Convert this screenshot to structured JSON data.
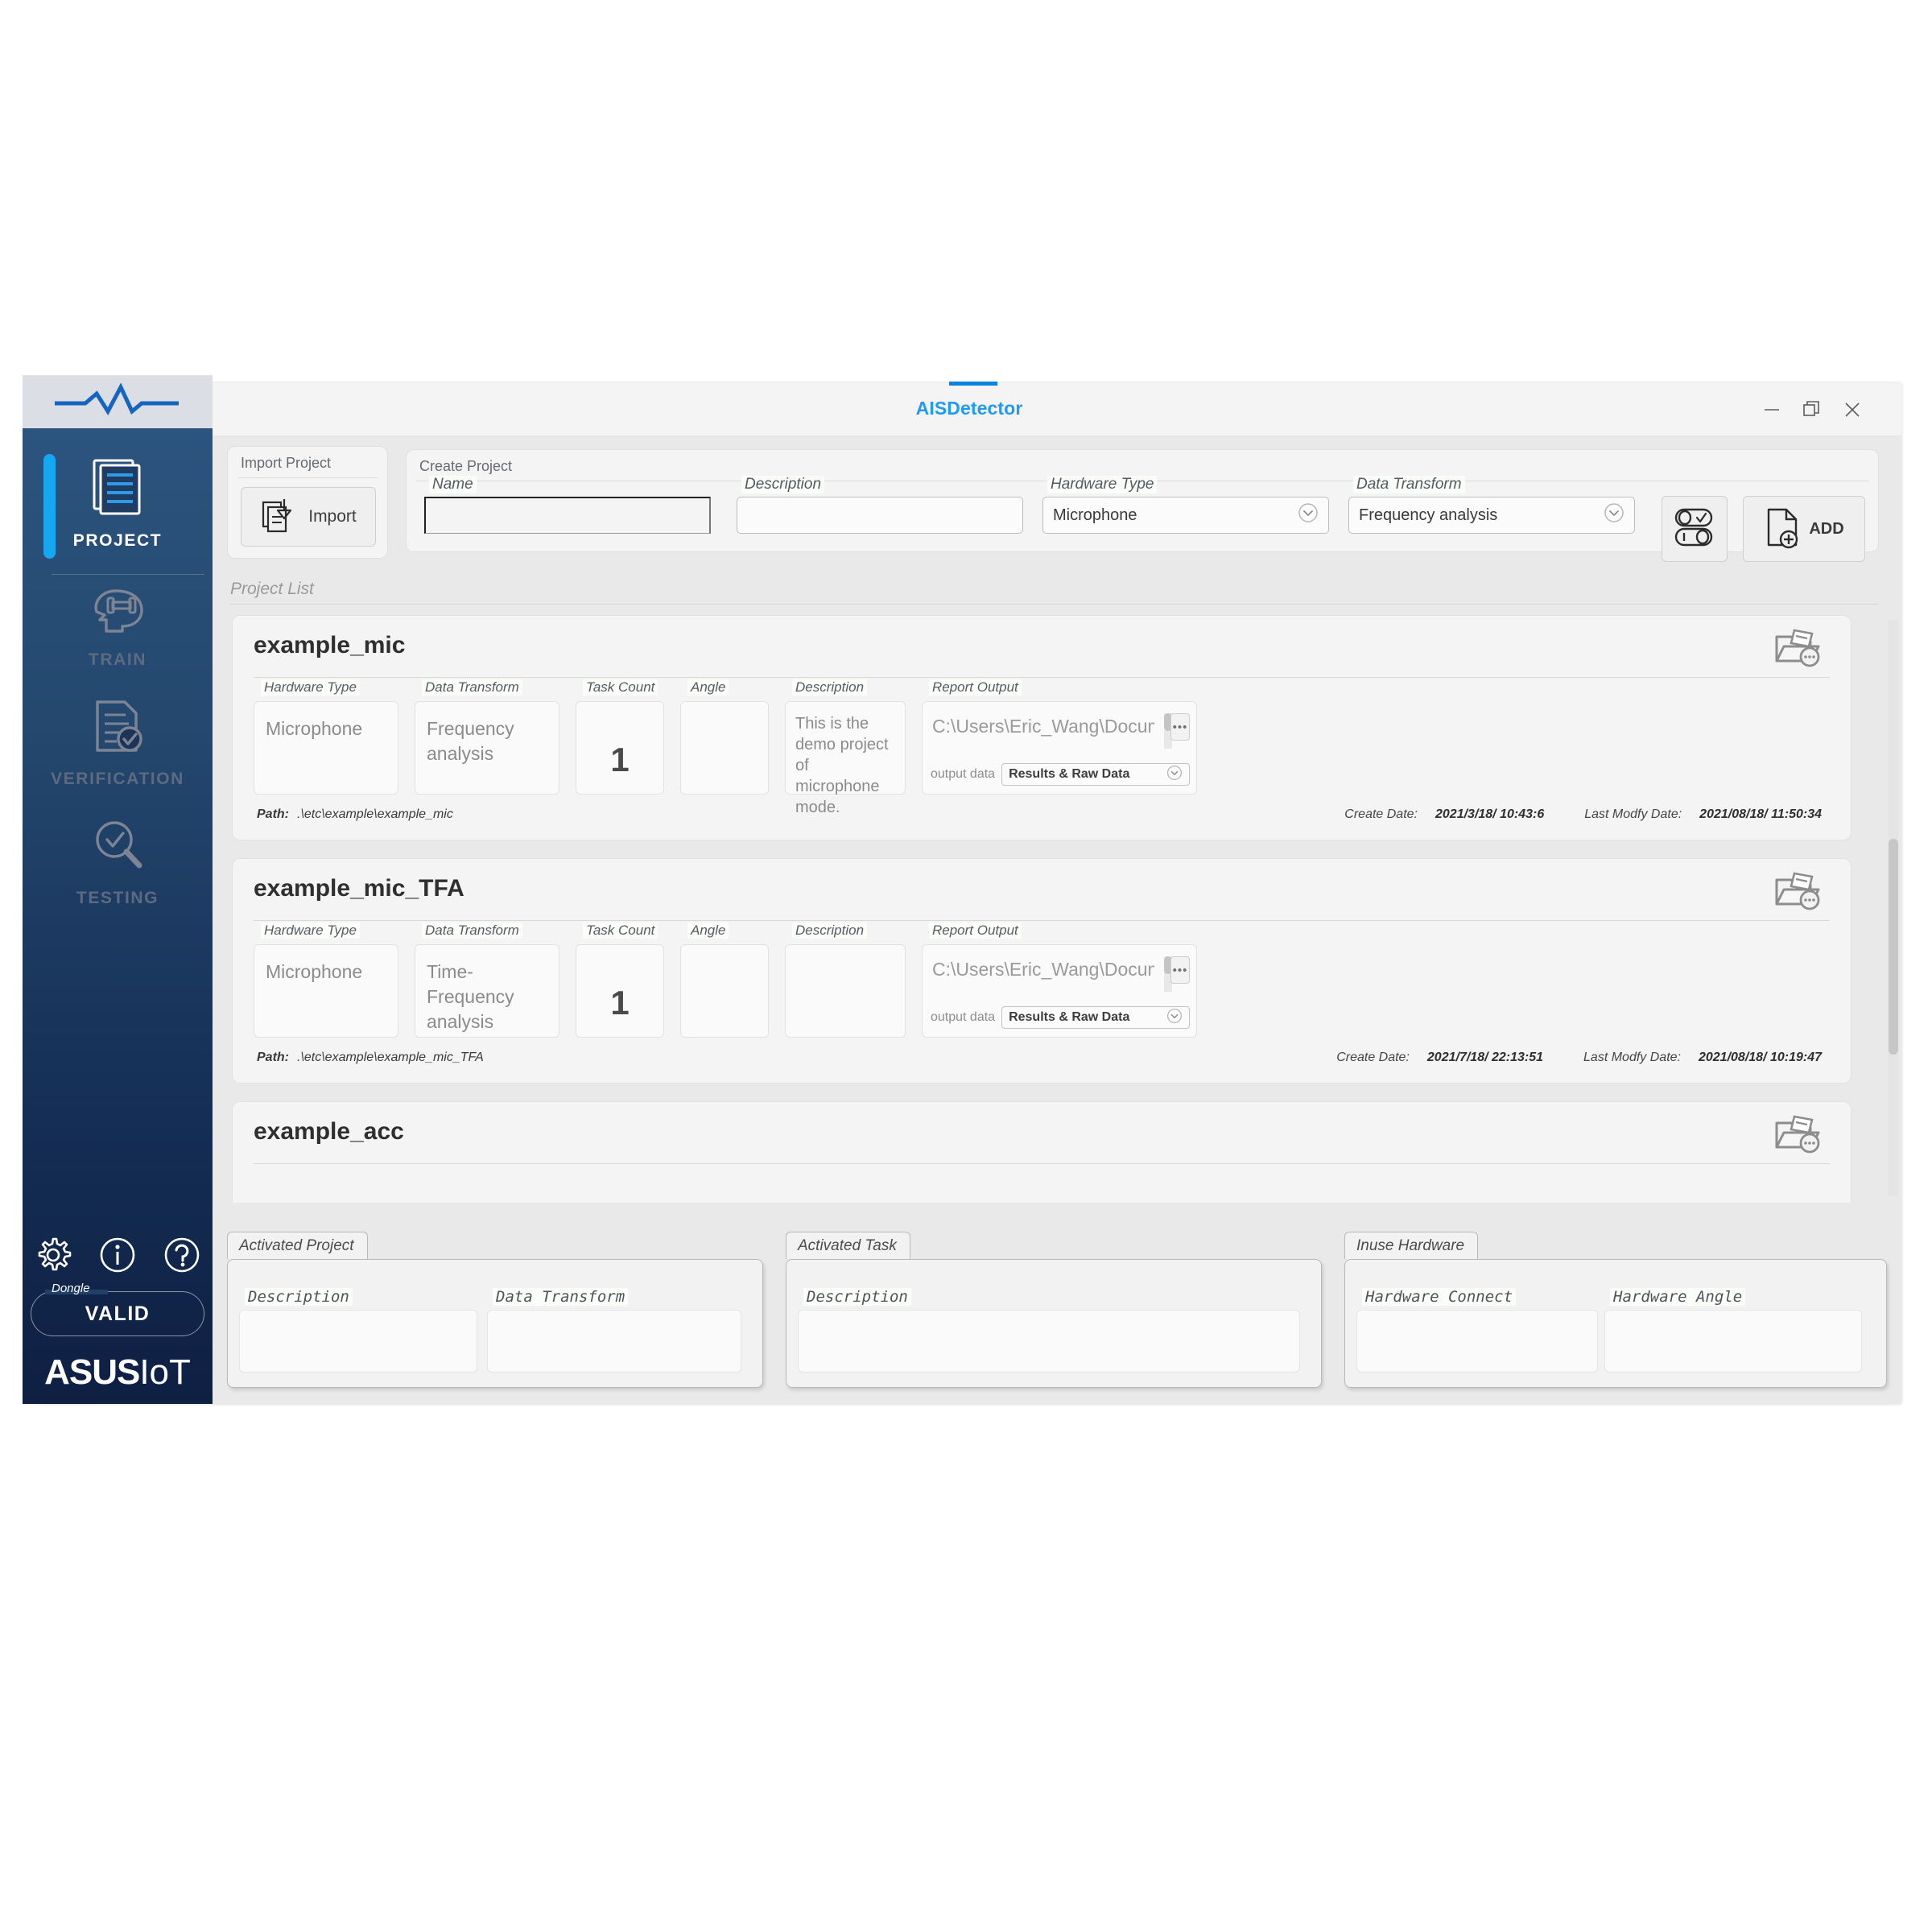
{
  "window": {
    "title": "AISDetector",
    "minimize_label": "minimize-window",
    "maximize_label": "restore-window",
    "close_label": "close-window"
  },
  "sidebar": {
    "items": [
      {
        "label": "PROJECT",
        "icon": "documents-icon",
        "active": true
      },
      {
        "label": "TRAIN",
        "icon": "brain-dumbbell-icon",
        "active": false
      },
      {
        "label": "VERIFICATION",
        "icon": "document-check-icon",
        "active": false
      },
      {
        "label": "TESTING",
        "icon": "magnifier-check-icon",
        "active": false
      }
    ],
    "tool_icons": [
      {
        "name": "gear-icon"
      },
      {
        "name": "info-icon"
      },
      {
        "name": "help-icon"
      }
    ],
    "dongle": {
      "label": "Dongle",
      "status": "VALID"
    },
    "brand": {
      "asus": "ASUS",
      "iot": "IoT"
    }
  },
  "import": {
    "group_title": "Import Project",
    "button_label": "Import",
    "icon": "import-document-icon"
  },
  "create": {
    "group_title": "Create Project",
    "fields": {
      "name": {
        "label": "Name",
        "value": "",
        "placeholder": ""
      },
      "description": {
        "label": "Description",
        "value": "",
        "placeholder": ""
      },
      "hardware_type": {
        "label": "Hardware Type",
        "value": "Microphone"
      },
      "data_transform": {
        "label": "Data Transform",
        "value": "Frequency analysis"
      }
    },
    "toggle_icon": "toggle-switches-icon",
    "add_label": "ADD",
    "add_icon": "document-plus-icon"
  },
  "project_list": {
    "title": "Project List",
    "column_labels": {
      "hardware_type": "Hardware Type",
      "data_transform": "Data Transform",
      "task_count": "Task Count",
      "angle": "Angle",
      "description": "Description",
      "report_output": "Report Output"
    },
    "labels": {
      "path": "Path:",
      "create_date": "Create Date:",
      "last_modify_date": "Last Modfy Date:",
      "output_data": "output data",
      "more": "•••"
    },
    "projects": [
      {
        "name": "example_mic",
        "hardware_type": "Microphone",
        "data_transform": "Frequency analysis",
        "task_count": "1",
        "angle": "",
        "description": "This is the demo project of microphone mode.",
        "report_path": "C:\\Users\\Eric_Wang\\Documents\\AIS",
        "output_data": "Results & Raw Data",
        "path": ".\\etc\\example\\example_mic",
        "create_date": "2021/3/18/ 10:43:6",
        "last_modify_date": "2021/08/18/ 11:50:34"
      },
      {
        "name": "example_mic_TFA",
        "hardware_type": "Microphone",
        "data_transform": "Time-Frequency analysis",
        "task_count": "1",
        "angle": "",
        "description": "",
        "report_path": "C:\\Users\\Eric_Wang\\Documents\\AIS",
        "output_data": "Results & Raw Data",
        "path": ".\\etc\\example\\example_mic_TFA",
        "create_date": "2021/7/18/ 22:13:51",
        "last_modify_date": "2021/08/18/ 10:19:47"
      },
      {
        "name": "example_acc",
        "hardware_type": "",
        "data_transform": "",
        "task_count": "",
        "angle": "",
        "description": "",
        "report_path": "",
        "output_data": "",
        "path": "",
        "create_date": "",
        "last_modify_date": ""
      }
    ]
  },
  "status_bar": {
    "activated_project": {
      "tab": "Activated Project",
      "description_label": "Description",
      "description_value": "",
      "data_transform_label": "Data Transform",
      "data_transform_value": ""
    },
    "activated_task": {
      "tab": "Activated Task",
      "description_label": "Description",
      "description_value": ""
    },
    "inuse_hardware": {
      "tab": "Inuse Hardware",
      "hardware_connect_label": "Hardware Connect",
      "hardware_connect_value": "",
      "hardware_angle_label": "Hardware Angle",
      "hardware_angle_value": ""
    }
  },
  "colors": {
    "accent_blue": "#1f9af5",
    "sidebar_top": "#2d5681",
    "sidebar_bottom": "#0e1f42",
    "active_bar": "#17a7f0"
  }
}
